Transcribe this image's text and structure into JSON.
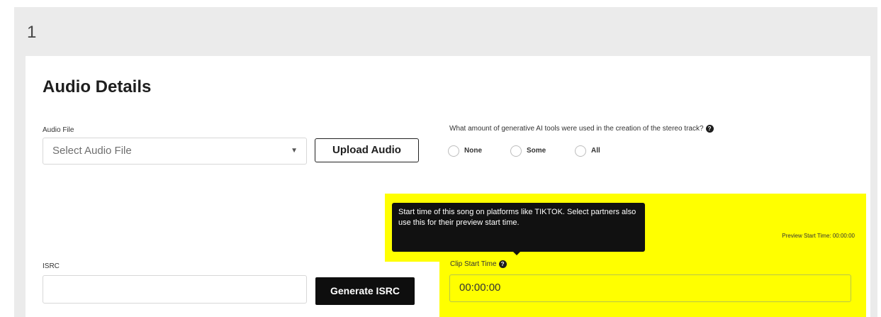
{
  "section": {
    "number": "1",
    "title": "Audio Details"
  },
  "audio_file": {
    "label": "Audio File",
    "select_value": "Select Audio File",
    "upload_button": "Upload Audio"
  },
  "ai_tools": {
    "question": "What amount of generative AI tools were used in the creation of the stereo track?",
    "help_icon": "?",
    "options": [
      "None",
      "Some",
      "All"
    ]
  },
  "tooltip": {
    "text": "Start time of this song on platforms like TIKTOK. Select partners also use this for their preview start time."
  },
  "preview": {
    "text": "Preview Start Time: 00:00:00"
  },
  "isrc": {
    "label": "ISRC",
    "value": "",
    "generate_button": "Generate ISRC"
  },
  "clip_start": {
    "label": "Clip Start Time",
    "help_icon": "?",
    "value": "00:00:00"
  },
  "colors": {
    "highlight": "#ffff00",
    "panel_bg": "#ebebeb",
    "card_bg": "#ffffff",
    "dark_button": "#0e0e0e"
  }
}
